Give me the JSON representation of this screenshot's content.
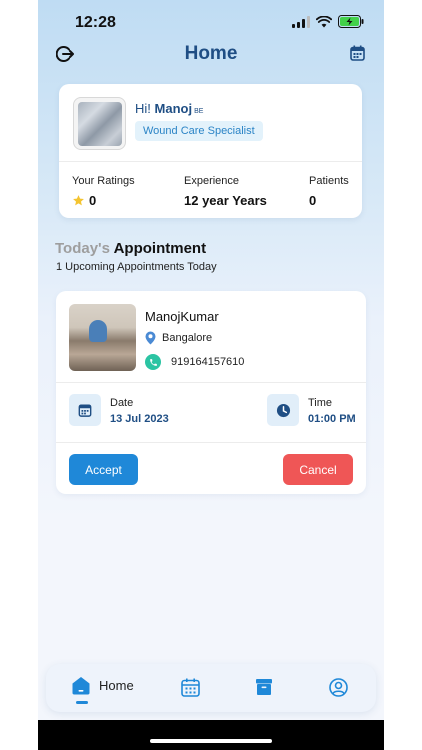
{
  "status_bar": {
    "time": "12:28"
  },
  "header": {
    "title": "Home"
  },
  "profile": {
    "greeting": "Hi!",
    "name": "Manoj",
    "degree": "BE",
    "specialty": "Wound Care Specialist",
    "stats": [
      {
        "label": "Your Ratings",
        "value": "0",
        "icon": "star-icon"
      },
      {
        "label": "Experience",
        "value": "12 year Years"
      },
      {
        "label": "Patients",
        "value": "0"
      }
    ]
  },
  "appointments": {
    "title_muted": "Today's",
    "title_strong": "Appointment",
    "subtitle": "1 Upcoming Appointments Today",
    "items": [
      {
        "patient_name": "ManojKumar",
        "location": "Bangalore",
        "phone": "919164157610",
        "date_label": "Date",
        "date_value": "13 Jul 2023",
        "time_label": "Time",
        "time_value": "01:00 PM",
        "accept_label": "Accept",
        "cancel_label": "Cancel"
      }
    ]
  },
  "bottom_nav": {
    "items": [
      {
        "label": "Home",
        "icon": "home-icon",
        "active": true
      },
      {
        "label": "",
        "icon": "calendar-icon"
      },
      {
        "label": "",
        "icon": "archive-box-icon"
      },
      {
        "label": "",
        "icon": "profile-icon"
      }
    ]
  },
  "colors": {
    "primary": "#1f4e84",
    "accent": "#1f88d8",
    "accept": "#1f88d8",
    "cancel": "#ef5656",
    "chip_bg": "#e3f2fb",
    "phone_green": "#2bc4a3"
  }
}
